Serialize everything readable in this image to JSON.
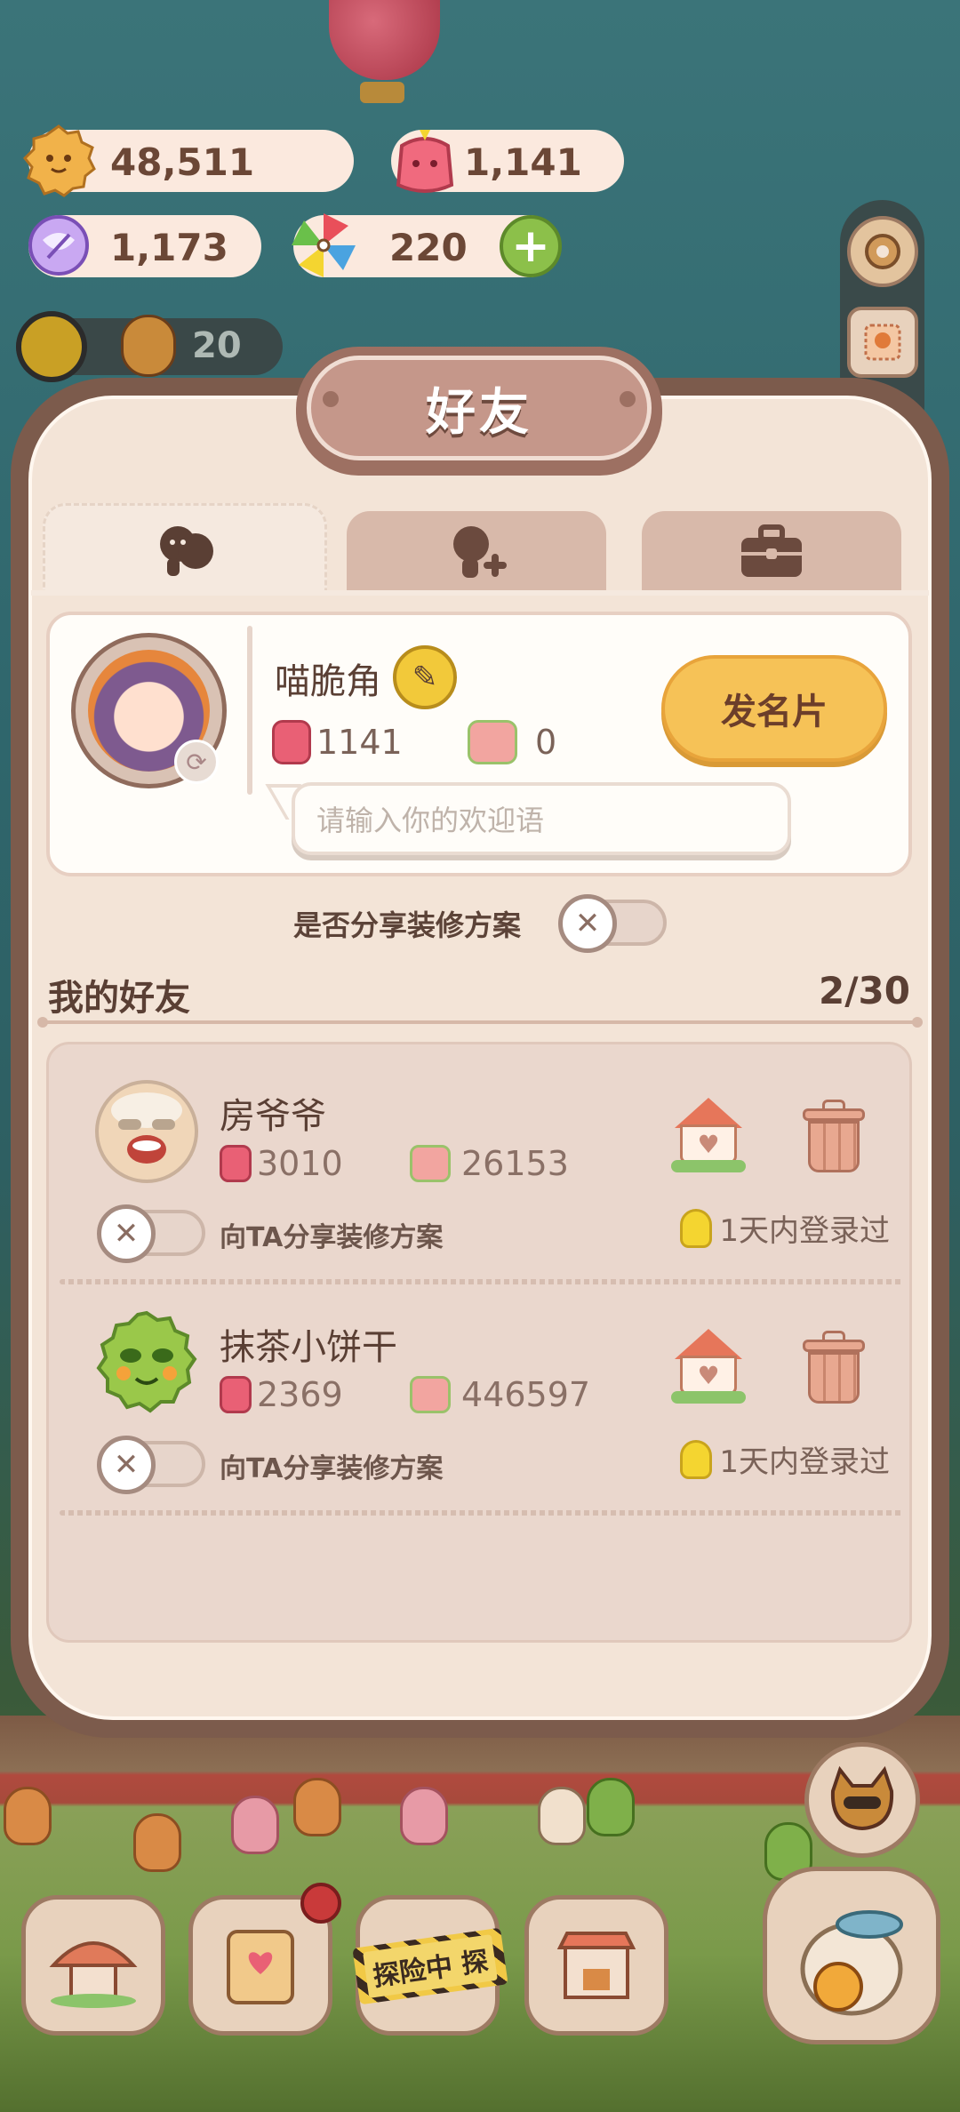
{
  "resources": {
    "cookies": "48,511",
    "jelly": "1,141",
    "crystal": "1,173",
    "rainbow": "220",
    "level_cookies": "20"
  },
  "icons": {
    "cookie": "cookie-icon",
    "jelly": "jelly-icon",
    "crystal": "crystal-icon",
    "rainbow": "rainbow-pinwheel-icon",
    "plus": "plus-icon"
  },
  "dialog": {
    "title": "好友",
    "tabs": [
      {
        "name": "friends-tab",
        "icon": "friends-icon",
        "active": true
      },
      {
        "name": "add-friend-tab",
        "icon": "add-friend-icon",
        "active": false
      },
      {
        "name": "briefcase-tab",
        "icon": "briefcase-icon",
        "active": false
      }
    ]
  },
  "profile": {
    "nickname": "喵脆角",
    "jelly_count": "1141",
    "card_count": "0",
    "send_card_label": "发名片",
    "greeting_placeholder": "请输入你的欢迎语"
  },
  "share_plan_label": "是否分享装修方案",
  "friends": {
    "header": "我的好友",
    "count": "2/30",
    "list": [
      {
        "name": "房爷爷",
        "jelly": "3010",
        "cards": "26153",
        "share_label": "向TA分享装修方案",
        "login_status": "1天内登录过"
      },
      {
        "name": "抹茶小饼干",
        "jelly": "2369",
        "cards": "446597",
        "share_label": "向TA分享装修方案",
        "login_status": "1天内登录过"
      }
    ]
  },
  "bottom_bar": {
    "explore_label": "探险中 探"
  },
  "colors": {
    "panel_border": "#7c5b4c",
    "panel_bg": "#f3e4d7",
    "send_button": "#f6c257",
    "plus_button": "#8cc04a"
  }
}
